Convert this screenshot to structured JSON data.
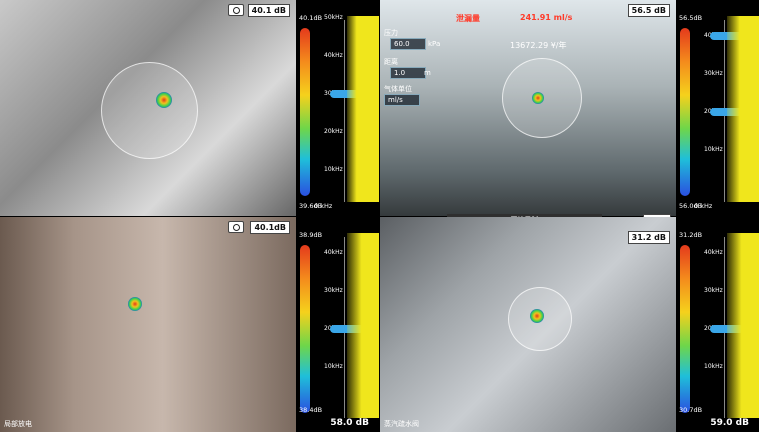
{
  "panels": [
    {
      "db": "40.1 dB",
      "spectrum": {
        "top_db": "40.1dB",
        "bottom_db": "39.6dB",
        "range_hz": "50kHz",
        "marker_hz": "30kHz",
        "ticks": [
          "40kHz",
          "30kHz",
          "20kHz",
          "10kHz",
          "0 kHz"
        ]
      },
      "overlay_label": "",
      "timestamp": "",
      "bottom_db": ""
    },
    {
      "db": "56.5 dB",
      "header": {
        "alarm_label": "泄漏量",
        "value": "241.91 ml/s",
        "annual": "13672.29 ¥/年"
      },
      "fields": {
        "pressure_label": "压力",
        "pressure_value": "60.0",
        "pressure_unit": "kPa",
        "distance_label": "距离",
        "distance_value": "1.0",
        "distance_unit": "m",
        "gas_label": "气体单位",
        "gas_value": "ml/s"
      },
      "spectrum": {
        "top_db": "56.5dB",
        "bottom_db": "56.0dB",
        "ticks": [
          "40kHz",
          "30kHz",
          "20kHz",
          "10kHz",
          "0 kHz"
        ],
        "marker_hz": "20kHz"
      },
      "record_button": "开始录制",
      "time": "00:00",
      "db2": "31.2 dB"
    },
    {
      "db": "38.9 dB",
      "spectrum": {
        "top_db": "38.9dB",
        "bottom_db": "38.4dB",
        "ticks": [
          "40kHz",
          "30kHz",
          "20kHz",
          "10kHz",
          "0 kHz"
        ],
        "marker_hz": "20kHz"
      },
      "bottom_label": "局部放电",
      "big_db": "58.0 dB"
    },
    {
      "spectrum": {
        "top_db": "31.2dB",
        "bottom_db": "30.7dB",
        "ticks": [
          "40kHz",
          "30kHz",
          "20kHz",
          "10kHz",
          "0 kHz"
        ],
        "marker_hz": "20kHz"
      },
      "bottom_label": "蒸汽疏水阀",
      "big_db": "59.0 dB"
    }
  ]
}
